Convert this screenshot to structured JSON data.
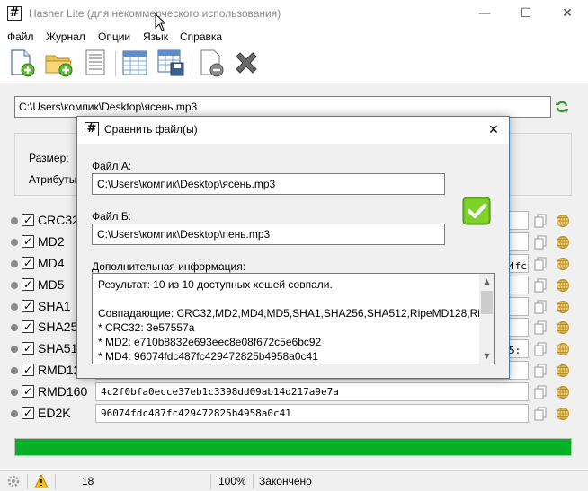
{
  "window": {
    "title": "Hasher Lite (для некоммерческого использования)",
    "icon_glyph": "#",
    "controls": {
      "minimize": "—",
      "maximize": "☐",
      "close": "✕"
    }
  },
  "menu": [
    "Файл",
    "Журнал",
    "Опции",
    "Язык",
    "Справка"
  ],
  "toolbar": {
    "icons": [
      "new-file-icon",
      "open-folder-icon",
      "document-icon",
      "table-icon",
      "save-table-icon",
      "remove-file-icon",
      "delete-x-icon"
    ]
  },
  "file_path": "C:\\Users\\компик\\Desktop\\ясень.mp3",
  "file_info": {
    "size_label": "Размер:",
    "attributes_label": "Атрибуты"
  },
  "hashes": [
    {
      "name": "CRC32",
      "value": "",
      "checked": true
    },
    {
      "name": "MD2",
      "value": "",
      "checked": true
    },
    {
      "name": "MD4",
      "value": "",
      "checked": true
    },
    {
      "name": "MD5",
      "value": "",
      "checked": true
    },
    {
      "name": "SHA1",
      "value": "",
      "checked": true
    },
    {
      "name": "SHA256",
      "value": "",
      "checked": true
    },
    {
      "name": "SHA512",
      "value": "",
      "checked": true
    },
    {
      "name": "RMD128",
      "value": "",
      "checked": true
    },
    {
      "name": "RMD160",
      "value": "4c2f0bfa0ecce37eb1c3398dd09ab14d217a9e7a",
      "checked": true
    },
    {
      "name": "ED2K",
      "value": "96074fdc487fc429472825b4958a0c41",
      "checked": true
    }
  ],
  "hidden_fragments": {
    "md4_tail": "4fc",
    "sha512_tail": "5:"
  },
  "progress": {
    "percent": 100,
    "color": "#06b025"
  },
  "statusbar": {
    "count": "18",
    "percent": "100%",
    "status": "Закончено"
  },
  "dialog": {
    "title": "Сравнить файл(ы)",
    "icon_glyph": "#",
    "close": "✕",
    "file_a_label": "Файл А:",
    "file_a_value": "C:\\Users\\компик\\Desktop\\ясень.mp3",
    "file_b_label": "Файл Б:",
    "file_b_value": "C:\\Users\\компик\\Desktop\\пень.mp3",
    "info_label": "Дополнительная информация:",
    "info_lines": [
      "Результат: 10 из 10 доступных хешей совпали.",
      "",
      "Совпадающие: CRC32,MD2,MD4,MD5,SHA1,SHA256,SHA512,RipeMD128,RipeM",
      "* CRC32: 3e57557a",
      "* MD2: e710b8832e693eec8e08f672c5e6bc92",
      "* MD4: 96074fdc487fc429472825b4958a0c41"
    ],
    "ok_color": "#6cbf1c"
  }
}
